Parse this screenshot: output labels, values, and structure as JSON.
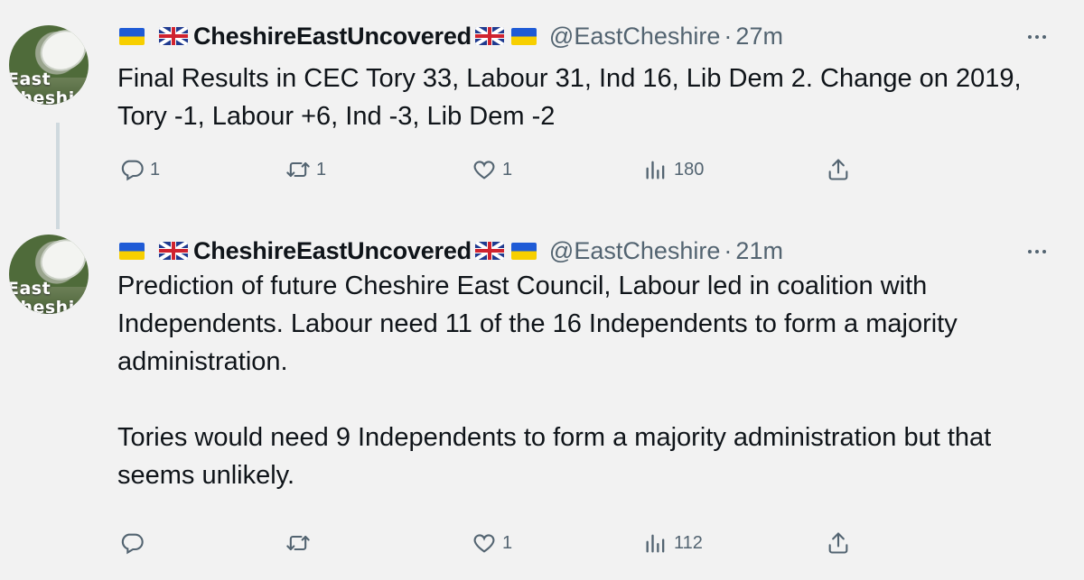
{
  "tweets": [
    {
      "display_name": "CheshireEastUncovered",
      "handle": "@EastCheshire",
      "separator": "·",
      "time": "27m",
      "avatar_text": "East\nCheshi",
      "text": "Final Results in CEC Tory 33, Labour 31, Ind 16, Lib Dem 2. Change on 2019, Tory -1, Labour +6, Ind -3, Lib Dem -2",
      "replies": "1",
      "retweets": "1",
      "likes": "1",
      "views": "180"
    },
    {
      "display_name": "CheshireEastUncovered",
      "handle": "@EastCheshire",
      "separator": "·",
      "time": "21m",
      "avatar_text": "East\nCheshi",
      "text": "Prediction of future Cheshire East Council, Labour led in coalition with Independents. Labour need 11 of the 16 Independents to form a majority administration.\n\nTories would need 9 Independents to form a majority administration but that seems unlikely.",
      "replies": "",
      "retweets": "",
      "likes": "1",
      "views": "112"
    }
  ],
  "icons": {
    "flag_left": "ukraine-flag",
    "flag_uk": "union-jack-flag",
    "more": "more-horizontal-icon",
    "reply": "reply-icon",
    "retweet": "retweet-icon",
    "like": "heart-icon",
    "views": "views-icon",
    "share": "share-icon"
  },
  "colors": {
    "background": "#f2f2f2",
    "text": "#0f1419",
    "secondary": "#536471",
    "thread_line": "#cfd9de"
  }
}
